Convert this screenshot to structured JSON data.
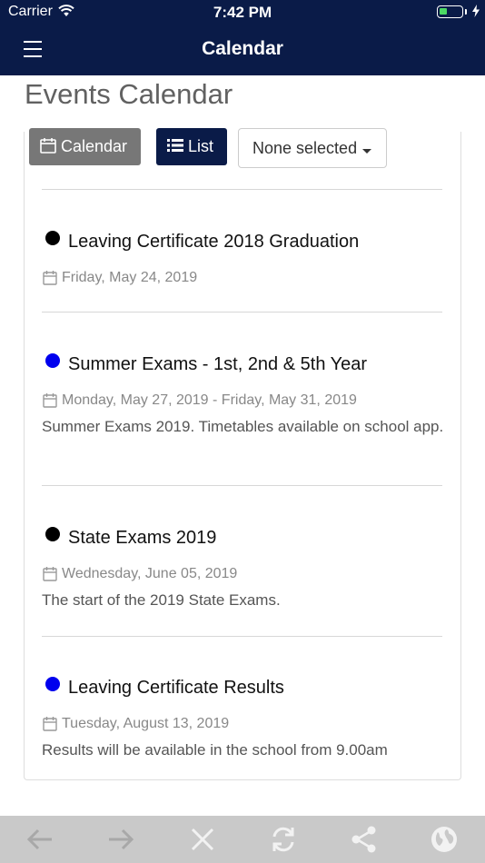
{
  "status_bar": {
    "carrier": "Carrier",
    "time": "7:42 PM",
    "battery_level": 0.35
  },
  "nav": {
    "title": "Calendar"
  },
  "page": {
    "title": "Events Calendar"
  },
  "toolbar": {
    "calendar_label": "Calendar",
    "list_label": "List",
    "filter_value": "None selected"
  },
  "events": [
    {
      "title": "Leaving Certificate 2018 Graduation",
      "date": "Friday, May 24, 2019",
      "description": "",
      "dot_color": "#000000"
    },
    {
      "title": "Summer Exams - 1st, 2nd & 5th Year",
      "date": "Monday, May 27, 2019 - Friday, May 31, 2019",
      "description": "Summer Exams 2019. Timetables available on school app.",
      "dot_color": "#0000ee"
    },
    {
      "title": "State Exams 2019",
      "date": "Wednesday, June 05, 2019",
      "description": "The start of the 2019 State Exams.",
      "dot_color": "#000000"
    },
    {
      "title": "Leaving Certificate Results",
      "date": "Tuesday, August 13, 2019",
      "description": "Results will be available in the school from 9.00am",
      "dot_color": "#0000ee"
    }
  ],
  "bottom_toolbar": {
    "icons": [
      "back-arrow-icon",
      "forward-arrow-icon",
      "close-icon",
      "refresh-icon",
      "share-icon",
      "globe-icon"
    ]
  }
}
